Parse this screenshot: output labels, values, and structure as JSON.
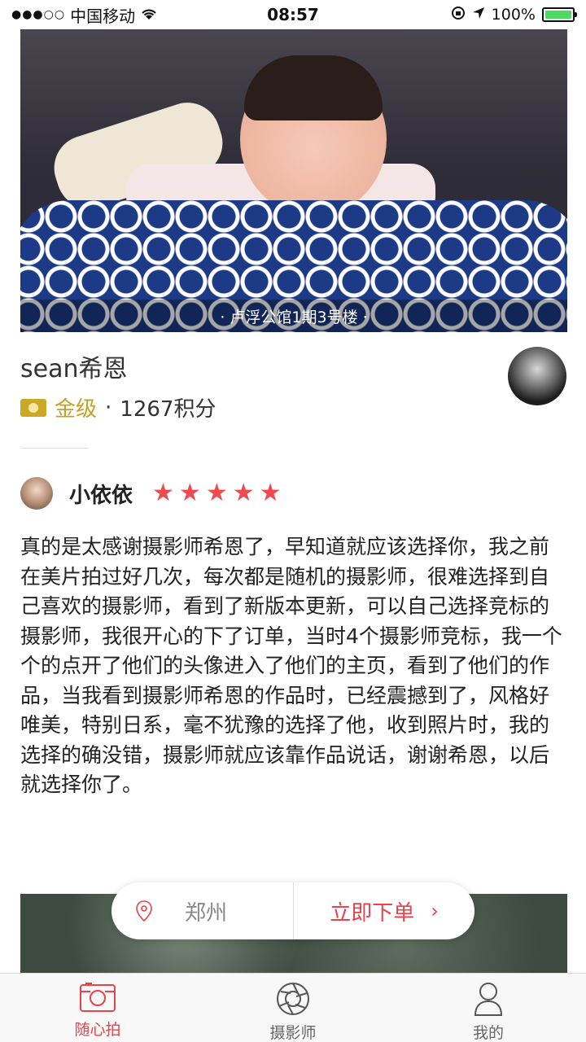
{
  "status_bar": {
    "carrier": "中国移动",
    "time": "08:57",
    "battery": "100%"
  },
  "hero": {
    "caption": "· 卢浮公馆1期3号楼 ·"
  },
  "photographer": {
    "name": "sean希恩",
    "level": "金级",
    "separator": "·",
    "points": "1267积分"
  },
  "review": {
    "reviewer": "小依依",
    "rating": 5,
    "stars": [
      "★",
      "★",
      "★",
      "★",
      "★"
    ],
    "text": "真的是太感谢摄影师希恩了，早知道就应该选择你，我之前在美片拍过好几次，每次都是随机的摄影师，很难选择到自己喜欢的摄影师，看到了新版本更新，可以自己选择竞标的摄影师，我很开心的下了订单，当时4个摄影师竞标，我一个个的点开了他们的头像进入了他们的主页，看到了他们的作品，当我看到摄影师希恩的作品时，已经震撼到了，风格好唯美，特别日系，毫不犹豫的选择了他，收到照片时，我的选择的确没错，摄影师就应该靠作品说话，谢谢希恩，以后就选择你了。"
  },
  "action": {
    "city": "郑州",
    "order_label": "立即下单",
    "chevron": "›"
  },
  "tabs": [
    {
      "label": "随心拍",
      "icon": "camera-icon",
      "active": true
    },
    {
      "label": "摄影师",
      "icon": "aperture-icon",
      "active": false
    },
    {
      "label": "我的",
      "icon": "user-icon",
      "active": false
    }
  ],
  "colors": {
    "accent": "#e8434b",
    "star": "#ef4a4e",
    "gold": "#c2a125"
  }
}
